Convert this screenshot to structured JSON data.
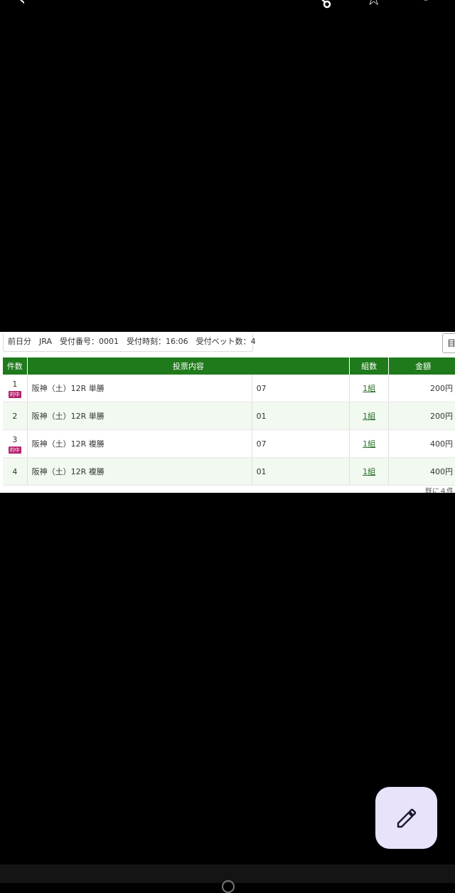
{
  "toolbar": {
    "back_icon": "chevron-left-icon",
    "share_icon": "share-icon",
    "favorite_icon": "star-outline-icon",
    "more_icon": "more-vert-icon"
  },
  "receipt": {
    "info": {
      "day": "前日分",
      "org": "JRA",
      "number": "受付番号：0001",
      "time": "受付時刻：16:06",
      "bet_count": "受付ベット数：4"
    },
    "corner_button": "目",
    "headers": {
      "no": "件数",
      "content": "投票内容",
      "combo": "組数",
      "amount": "金額"
    },
    "rows": [
      {
        "no": "1",
        "badge": "的中",
        "race": "阪神（土）12R 単勝",
        "horse": "07",
        "combo": "1組",
        "amount": "200円"
      },
      {
        "no": "2",
        "badge": "",
        "race": "阪神（土）12R 単勝",
        "horse": "01",
        "combo": "1組",
        "amount": "200円"
      },
      {
        "no": "3",
        "badge": "的中",
        "race": "阪神（土）12R 複勝",
        "horse": "07",
        "combo": "1組",
        "amount": "400円"
      },
      {
        "no": "4",
        "badge": "",
        "race": "阪神（土）12R 複勝",
        "horse": "01",
        "combo": "1組",
        "amount": "400円"
      }
    ],
    "footer": "既に４件"
  },
  "fab": {
    "icon": "pencil-icon"
  },
  "colors": {
    "background": "#000000",
    "header_green": "#1f7a1b",
    "hit_badge": "#b4246b",
    "fab_bg": "#e8e2fb"
  }
}
